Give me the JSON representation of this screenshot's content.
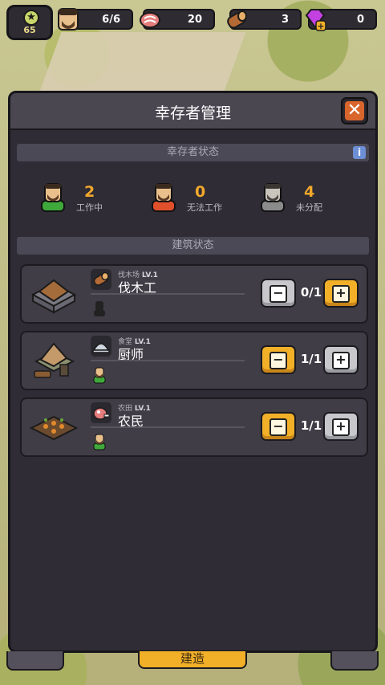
{
  "hud": {
    "level": "65",
    "survivors": "6/6",
    "meat": "20",
    "wood": "3",
    "gems": "0"
  },
  "panel": {
    "title": "幸存者管理",
    "close_label": "✕",
    "survivor_section": "幸存者状态",
    "info_label": "i",
    "stats": [
      {
        "count": "2",
        "label": "工作中",
        "color": "#3fa83b"
      },
      {
        "count": "0",
        "label": "无法工作",
        "color": "#e0502d"
      },
      {
        "count": "4",
        "label": "未分配",
        "color": "#8b8b8b"
      }
    ],
    "building_section": "建筑状态",
    "buildings": [
      {
        "building": "伐木场",
        "level": "LV.1",
        "job": "伐木工",
        "ratio": "0/1",
        "minus": "−",
        "plus": "+"
      },
      {
        "building": "食堂",
        "level": "LV.1",
        "job": "厨师",
        "ratio": "1/1",
        "minus": "−",
        "plus": "+"
      },
      {
        "building": "农田",
        "level": "LV.1",
        "job": "农民",
        "ratio": "1/1",
        "minus": "−",
        "plus": "+"
      }
    ]
  },
  "bottom": {
    "build_label": "建造"
  }
}
